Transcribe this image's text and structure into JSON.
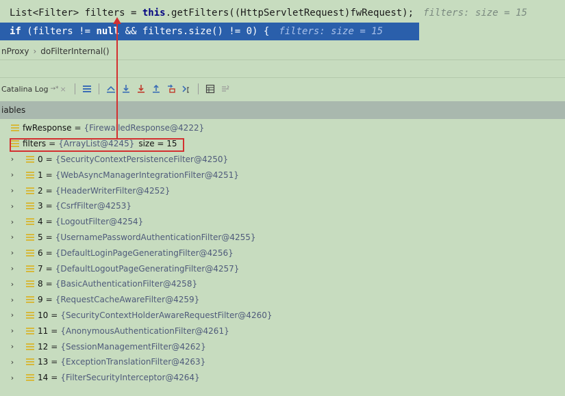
{
  "code": {
    "line1": {
      "text": "List<Filter> filters = ",
      "kw": "this",
      "rest": ".getFilters((HttpServletRequest)fwRequest);",
      "hint": "filters:  size = 15"
    },
    "line2": {
      "kw1": "if",
      "mid": " (filters != ",
      "kw2": "null",
      "rest": " && filters.size() != 0) {",
      "hint": "filters:  size = 15"
    }
  },
  "breadcrumb": {
    "items": [
      "nProxy",
      "doFilterInternal()"
    ],
    "separator": "›"
  },
  "toolbar": {
    "tab_label": "Catalina Log",
    "tab_pin": "→*",
    "tab_close": "×",
    "icons": [
      "list-icon",
      "show-execution-point-icon",
      "step-over-icon",
      "step-into-icon",
      "step-out-icon",
      "drop-frame-icon",
      "run-to-cursor-icon",
      "evaluate-icon",
      "trace-icon"
    ]
  },
  "variables": {
    "header": "iables",
    "top_items": [
      {
        "name": "fwResponse",
        "value": "{FirewalledResponse@4222}"
      },
      {
        "name": "filters",
        "value": "{ArrayList@4245}",
        "size": "size = 15"
      }
    ],
    "children": [
      {
        "name": "0",
        "value": "{SecurityContextPersistenceFilter@4250}"
      },
      {
        "name": "1",
        "value": "{WebAsyncManagerIntegrationFilter@4251}"
      },
      {
        "name": "2",
        "value": "{HeaderWriterFilter@4252}"
      },
      {
        "name": "3",
        "value": "{CsrfFilter@4253}"
      },
      {
        "name": "4",
        "value": "{LogoutFilter@4254}"
      },
      {
        "name": "5",
        "value": "{UsernamePasswordAuthenticationFilter@4255}"
      },
      {
        "name": "6",
        "value": "{DefaultLoginPageGeneratingFilter@4256}"
      },
      {
        "name": "7",
        "value": "{DefaultLogoutPageGeneratingFilter@4257}"
      },
      {
        "name": "8",
        "value": "{BasicAuthenticationFilter@4258}"
      },
      {
        "name": "9",
        "value": "{RequestCacheAwareFilter@4259}"
      },
      {
        "name": "10",
        "value": "{SecurityContextHolderAwareRequestFilter@4260}"
      },
      {
        "name": "11",
        "value": "{AnonymousAuthenticationFilter@4261}"
      },
      {
        "name": "12",
        "value": "{SessionManagementFilter@4262}"
      },
      {
        "name": "13",
        "value": "{ExceptionTranslationFilter@4263}"
      },
      {
        "name": "14",
        "value": "{FilterSecurityInterceptor@4264}"
      }
    ]
  },
  "colors": {
    "background": "#c7dcbf",
    "selected_line": "#2a5fab",
    "annotation": "#d32f2f",
    "field_icon": "#d6b83a"
  }
}
